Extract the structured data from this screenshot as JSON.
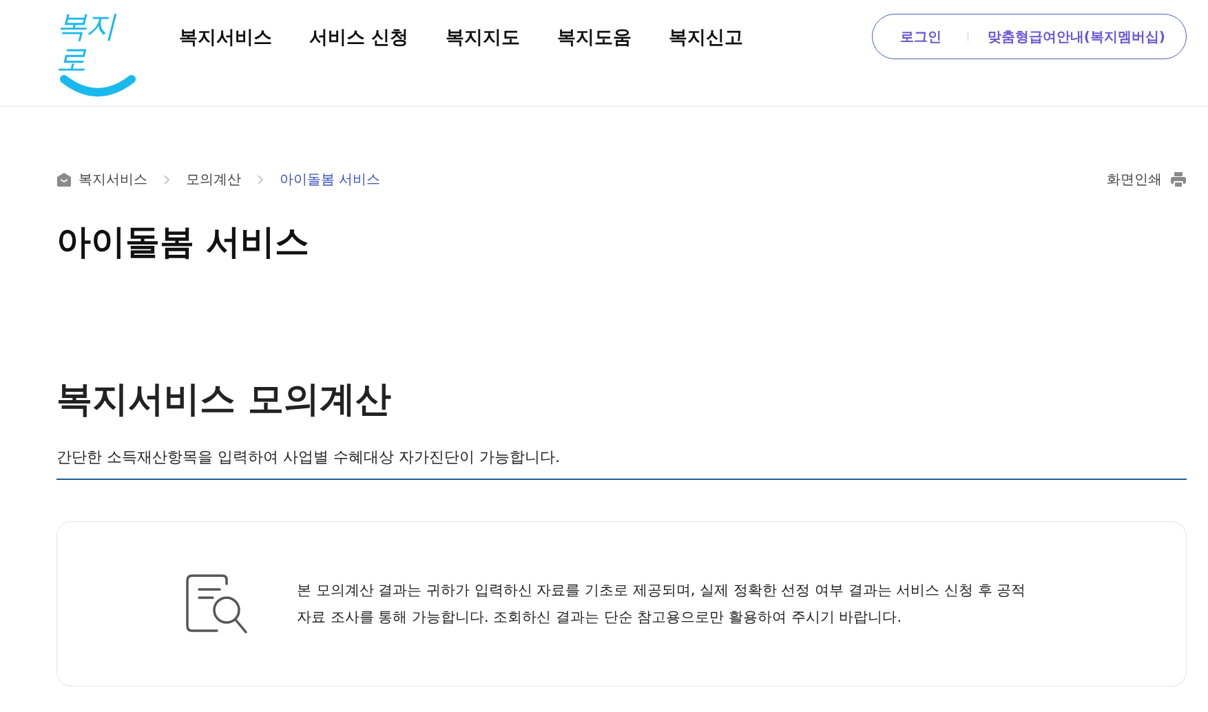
{
  "header": {
    "logo": "복지로",
    "nav": [
      "복지서비스",
      "서비스 신청",
      "복지지도",
      "복지도움",
      "복지신고"
    ],
    "account": [
      "로그인",
      "맞춤형급여안내(복지멤버십)"
    ]
  },
  "breadcrumb": [
    {
      "label": "복지서비스",
      "selected": false
    },
    {
      "label": "모의계산",
      "selected": false
    },
    {
      "label": "아이돌봄 서비스",
      "selected": true
    }
  ],
  "print": "화면인쇄",
  "page_title": "아이돌봄 서비스",
  "section": {
    "title": "복지서비스 모의계산",
    "description": "간단한 소득재산항목을 입력하여 사업별 수혜대상 자가진단이 가능합니다.",
    "notice": "본 모의계산 결과는 귀하가 입력하신 자료를 기초로 제공되며, 실제 정확한 선정 여부 결과는 서비스 신청 후 공적자료 조사를 통해 가능합니다. 조회하신 결과는 단순 참고용으로만 활용하여 주시기 바랍니다."
  }
}
